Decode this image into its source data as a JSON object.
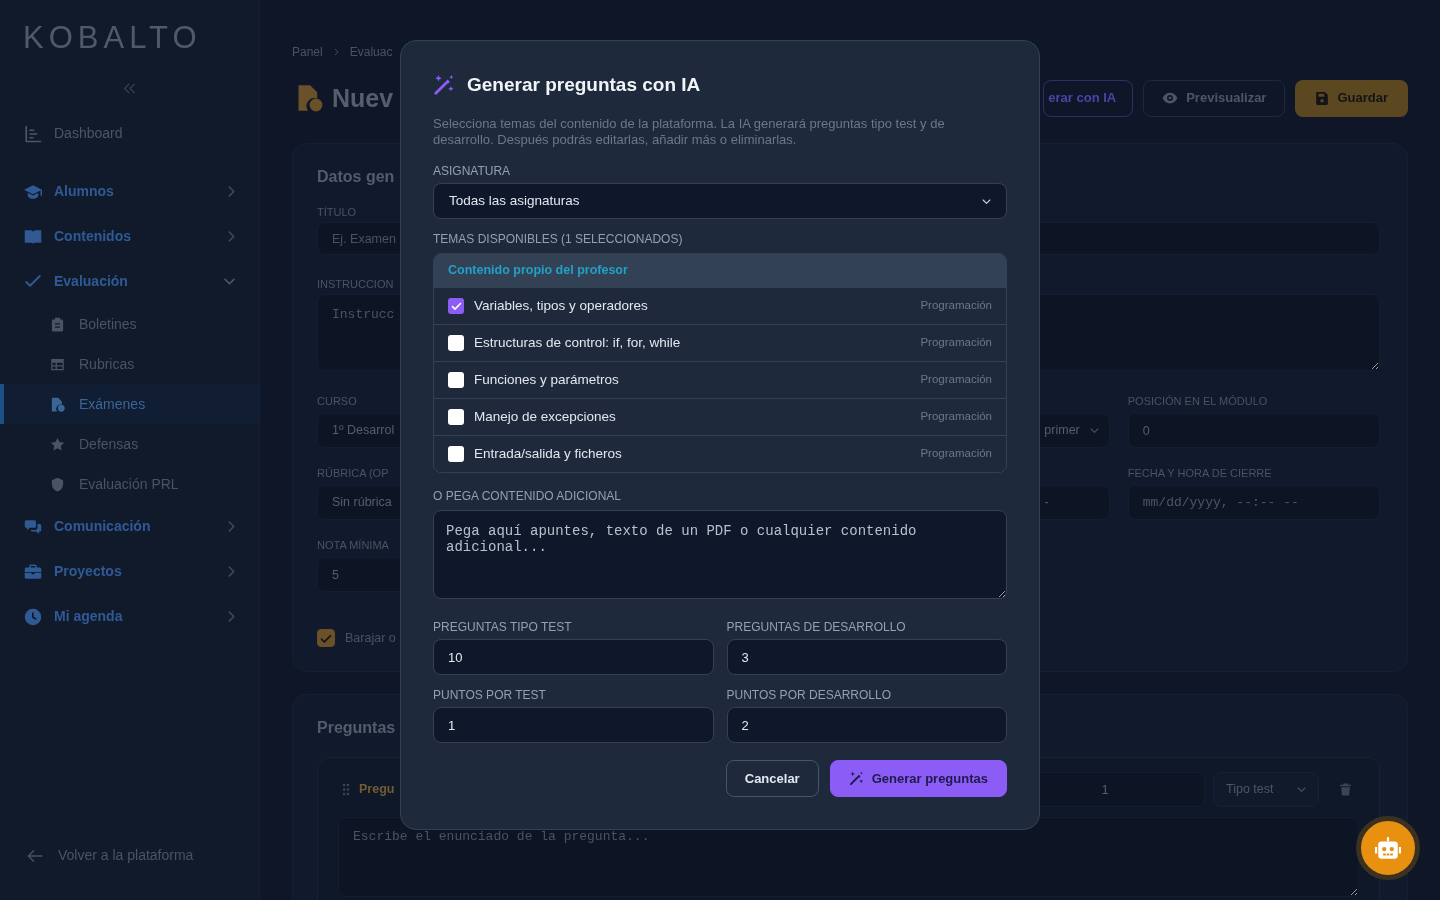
{
  "sidebar": {
    "logo": "KOBALTO",
    "items": [
      {
        "kind": "link",
        "label": "Dashboard"
      },
      {
        "kind": "group",
        "label": "Alumnos",
        "expanded": false
      },
      {
        "kind": "group",
        "label": "Contenidos",
        "expanded": false
      },
      {
        "kind": "group",
        "label": "Evaluación",
        "expanded": true,
        "children": [
          {
            "label": "Boletines",
            "selected": false
          },
          {
            "label": "Rubricas",
            "selected": false
          },
          {
            "label": "Exámenes",
            "selected": true
          },
          {
            "label": "Defensas",
            "selected": false
          },
          {
            "label": "Evaluación PRL",
            "selected": false
          }
        ]
      },
      {
        "kind": "group",
        "label": "Comunicación",
        "expanded": false
      },
      {
        "kind": "group",
        "label": "Proyectos",
        "expanded": false
      },
      {
        "kind": "group",
        "label": "Mi agenda",
        "expanded": false
      }
    ],
    "back_link": "Volver a la plataforma"
  },
  "page": {
    "breadcrumb": [
      "Panel",
      "Evaluac"
    ],
    "title": "Nuev",
    "actions": [
      {
        "kind": "ai",
        "label": "erar con IA"
      },
      {
        "kind": "preview",
        "label": "Previsualizar"
      },
      {
        "kind": "save",
        "label": "Guardar"
      }
    ],
    "general": {
      "title": "Datos gen",
      "title_field": {
        "label": "TÍTULO",
        "placeholder": "Ej. Examen"
      },
      "instructions_field": {
        "label": "INSTRUCCION",
        "placeholder": "Instrucc"
      },
      "course": {
        "label": "CURSO",
        "value": "1º Desarrol"
      },
      "select_3": {
        "value": "primer"
      },
      "position": {
        "label": "POSICIÓN EN EL MÓDULO",
        "value": "0"
      },
      "rubric": {
        "label": "RÚBRICA (OP",
        "value": "Sin rúbrica"
      },
      "field_3": {
        "value": "-"
      },
      "closing": {
        "label": "FECHA Y HORA DE CIERRE",
        "placeholder": "mm/dd/yyyy, --:-- --"
      },
      "min_grade": {
        "label": "NOTA MÍNIMA",
        "value": "5"
      },
      "shuffle": {
        "label": "Barajar o",
        "checked": true
      }
    },
    "questions": {
      "title": "Preguntas",
      "items": [
        {
          "title": "Pregu",
          "points": "1",
          "type": "Tipo test",
          "placeholder": "Escribe el enunciado de la pregunta..."
        }
      ]
    }
  },
  "modal": {
    "title": "Generar preguntas con IA",
    "description": "Selecciona temas del contenido de la plataforma. La IA generará preguntas tipo test y de desarrollo. Después podrás editarlas, añadir más o eliminarlas.",
    "subject": {
      "label": "ASIGNATURA",
      "value": "Todas las asignaturas"
    },
    "topics": {
      "label": "TEMAS DISPONIBLES (1 SELECCIONADOS)",
      "groups": [
        {
          "title": "Contenido propio del profesor",
          "items": [
            {
              "label": "Variables, tipos y operadores",
              "subject": "Programación",
              "checked": true
            },
            {
              "label": "Estructuras de control: if, for, while",
              "subject": "Programación",
              "checked": false
            },
            {
              "label": "Funciones y parámetros",
              "subject": "Programación",
              "checked": false
            },
            {
              "label": "Manejo de excepciones",
              "subject": "Programación",
              "checked": false
            },
            {
              "label": "Entrada/salida y ficheros",
              "subject": "Programación",
              "checked": false
            }
          ]
        }
      ]
    },
    "extra": {
      "label": "O PEGA CONTENIDO ADICIONAL",
      "placeholder": "Pega aquí apuntes, texto de un PDF o cualquier contenido adicional..."
    },
    "numbers": [
      {
        "label": "PREGUNTAS TIPO TEST",
        "value": "10"
      },
      {
        "label": "PREGUNTAS DE DESARROLLO",
        "value": "3"
      },
      {
        "label": "PUNTOS POR TEST",
        "value": "1"
      },
      {
        "label": "PUNTOS POR DESARROLLO",
        "value": "2"
      }
    ],
    "buttons": [
      {
        "kind": "secondary",
        "label": "Cancelar"
      },
      {
        "kind": "primary",
        "label": "Generar preguntas"
      }
    ]
  }
}
